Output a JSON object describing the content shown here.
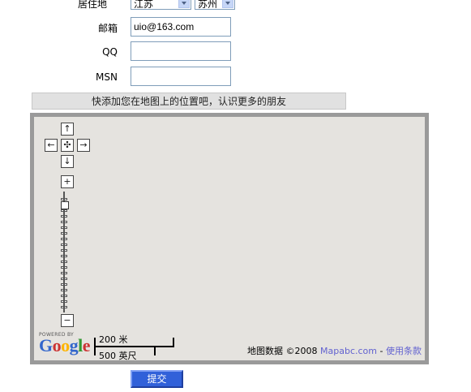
{
  "form": {
    "residence_label": "居住地",
    "province_value": "江苏",
    "city_value": "苏州",
    "email_label": "邮箱",
    "email_value": "uio@163.com",
    "qq_label": "QQ",
    "qq_value": "",
    "msn_label": "MSN",
    "msn_value": ""
  },
  "hint_bar": "快添加您在地图上的位置吧，认识更多的朋友",
  "map": {
    "pan_up": "↑",
    "pan_left": "←",
    "pan_center": "✣",
    "pan_right": "→",
    "pan_down": "↓",
    "zoom_in": "+",
    "zoom_out": "−",
    "powered_by": "POWERED BY",
    "scale_metric": "200 米",
    "scale_imperial": "500 英尺",
    "data_label": "地图数据",
    "copyright": "©2008",
    "provider": "Mapabc.com",
    "separator": "-",
    "terms": "使用条款"
  },
  "submit_label": "提交"
}
